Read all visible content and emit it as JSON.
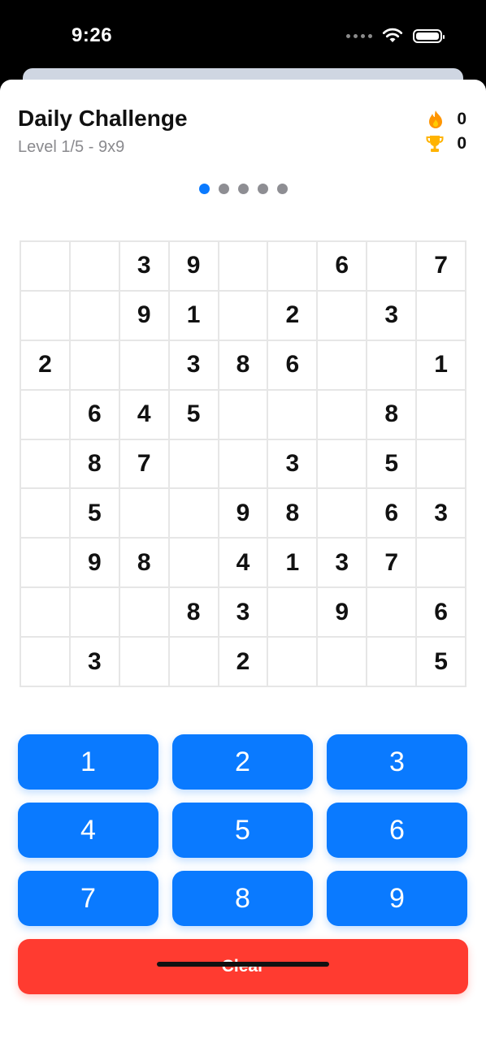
{
  "status": {
    "time": "9:26"
  },
  "header": {
    "title": "Daily Challenge",
    "subtitle": "Level 1/5 - 9x9"
  },
  "stats": {
    "streak": "0",
    "trophies": "0"
  },
  "pager": {
    "count": 5,
    "active_index": 0
  },
  "board": {
    "rows": [
      [
        "",
        "",
        "3",
        "9",
        "",
        "",
        "6",
        "",
        "7"
      ],
      [
        "",
        "",
        "9",
        "1",
        "",
        "2",
        "",
        "3",
        ""
      ],
      [
        "2",
        "",
        "",
        "3",
        "8",
        "6",
        "",
        "",
        "1"
      ],
      [
        "",
        "6",
        "4",
        "5",
        "",
        "",
        "",
        "8",
        ""
      ],
      [
        "",
        "8",
        "7",
        "",
        "",
        "3",
        "",
        "5",
        ""
      ],
      [
        "",
        "5",
        "",
        "",
        "9",
        "8",
        "",
        "6",
        "3"
      ],
      [
        "",
        "9",
        "8",
        "",
        "4",
        "1",
        "3",
        "7",
        ""
      ],
      [
        "",
        "",
        "",
        "8",
        "3",
        "",
        "9",
        "",
        "6"
      ],
      [
        "",
        "3",
        "",
        "",
        "2",
        "",
        "",
        "",
        "5"
      ]
    ]
  },
  "keypad": {
    "numbers": [
      "1",
      "2",
      "3",
      "4",
      "5",
      "6",
      "7",
      "8",
      "9"
    ],
    "clear_label": "Clear"
  },
  "colors": {
    "accent": "#0a7aff",
    "danger": "#ff3b30",
    "dot_inactive": "#8e8e93"
  }
}
